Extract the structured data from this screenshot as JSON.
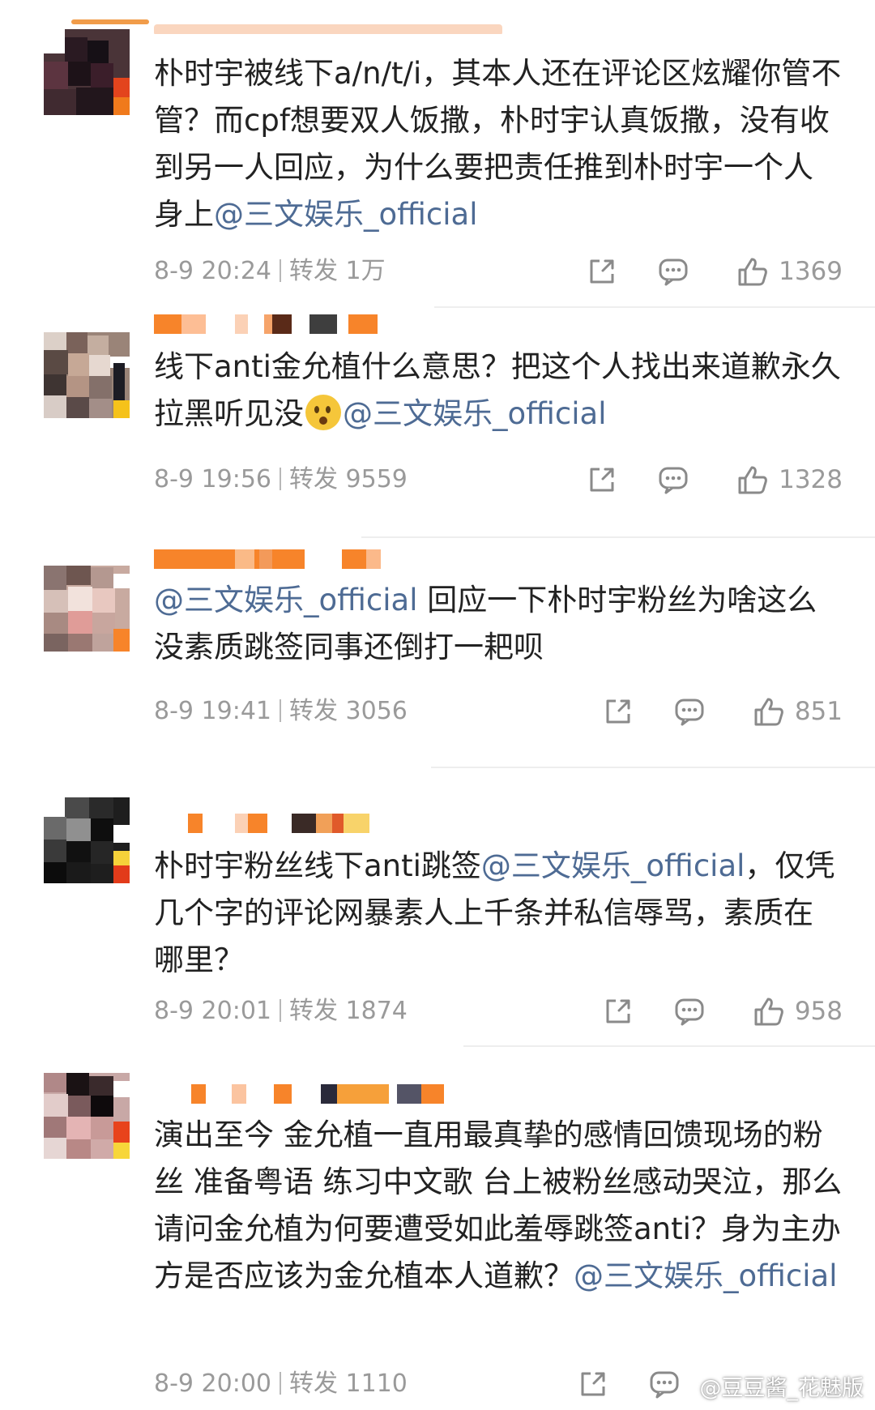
{
  "comments": [
    {
      "text_parts": [
        "朴时宇被线下a/n/t/i，其本人还在评论区炫耀你管不管？而cpf想要双人饭撒，朴时宇认真饭撒，没有收到另一人回应，为什么要把责任推到朴时宇一个人身上"
      ],
      "mention": "@三文娱乐_official",
      "date": "8-9 20:24",
      "repost_label": "转发",
      "repost_count": "1万",
      "likes": "1369"
    },
    {
      "text_parts": [
        "线下anti金允植什么意思？把这个人找出来道歉永久拉黑听见没"
      ],
      "mention": "@三文娱乐_official",
      "date": "8-9 19:56",
      "repost_label": "转发",
      "repost_count": "9559",
      "likes": "1328"
    },
    {
      "mention": "@三文娱乐_official",
      "text_parts": [
        " 回应一下朴时宇粉丝为啥这么没素质跳签同事还倒打一耙呗"
      ],
      "date": "8-9 19:41",
      "repost_label": "转发",
      "repost_count": "3056",
      "likes": "851"
    },
    {
      "text_parts": [
        "朴时宇粉丝线下anti跳签",
        "，仅凭几个字的评论网暴素人上千条并私信辱骂，素质在哪里？"
      ],
      "mention": "@三文娱乐_official",
      "date": "8-9 20:01",
      "repost_label": "转发",
      "repost_count": "1874",
      "likes": "958"
    },
    {
      "text_parts": [
        "演出至今 金允植一直用最真挚的感情回馈现场的粉丝 准备粤语 练习中文歌 台上被粉丝感动哭泣，那么请问金允植为何要遭受如此羞辱跳签anti？身为主办方是否应该为金允植本人道歉？"
      ],
      "mention": "@三文娱乐_official",
      "date": "8-9 20:00",
      "repost_label": "转发",
      "repost_count": "1110",
      "likes": ""
    }
  ],
  "watermark": "@豆豆酱_花魅版",
  "colors": {
    "mention": "#4e6b94",
    "meta": "#9a9a9a",
    "text": "#222222",
    "username_orange": "#f7842a"
  },
  "icons": [
    "share-icon",
    "comment-icon",
    "thumbs-up-icon"
  ]
}
